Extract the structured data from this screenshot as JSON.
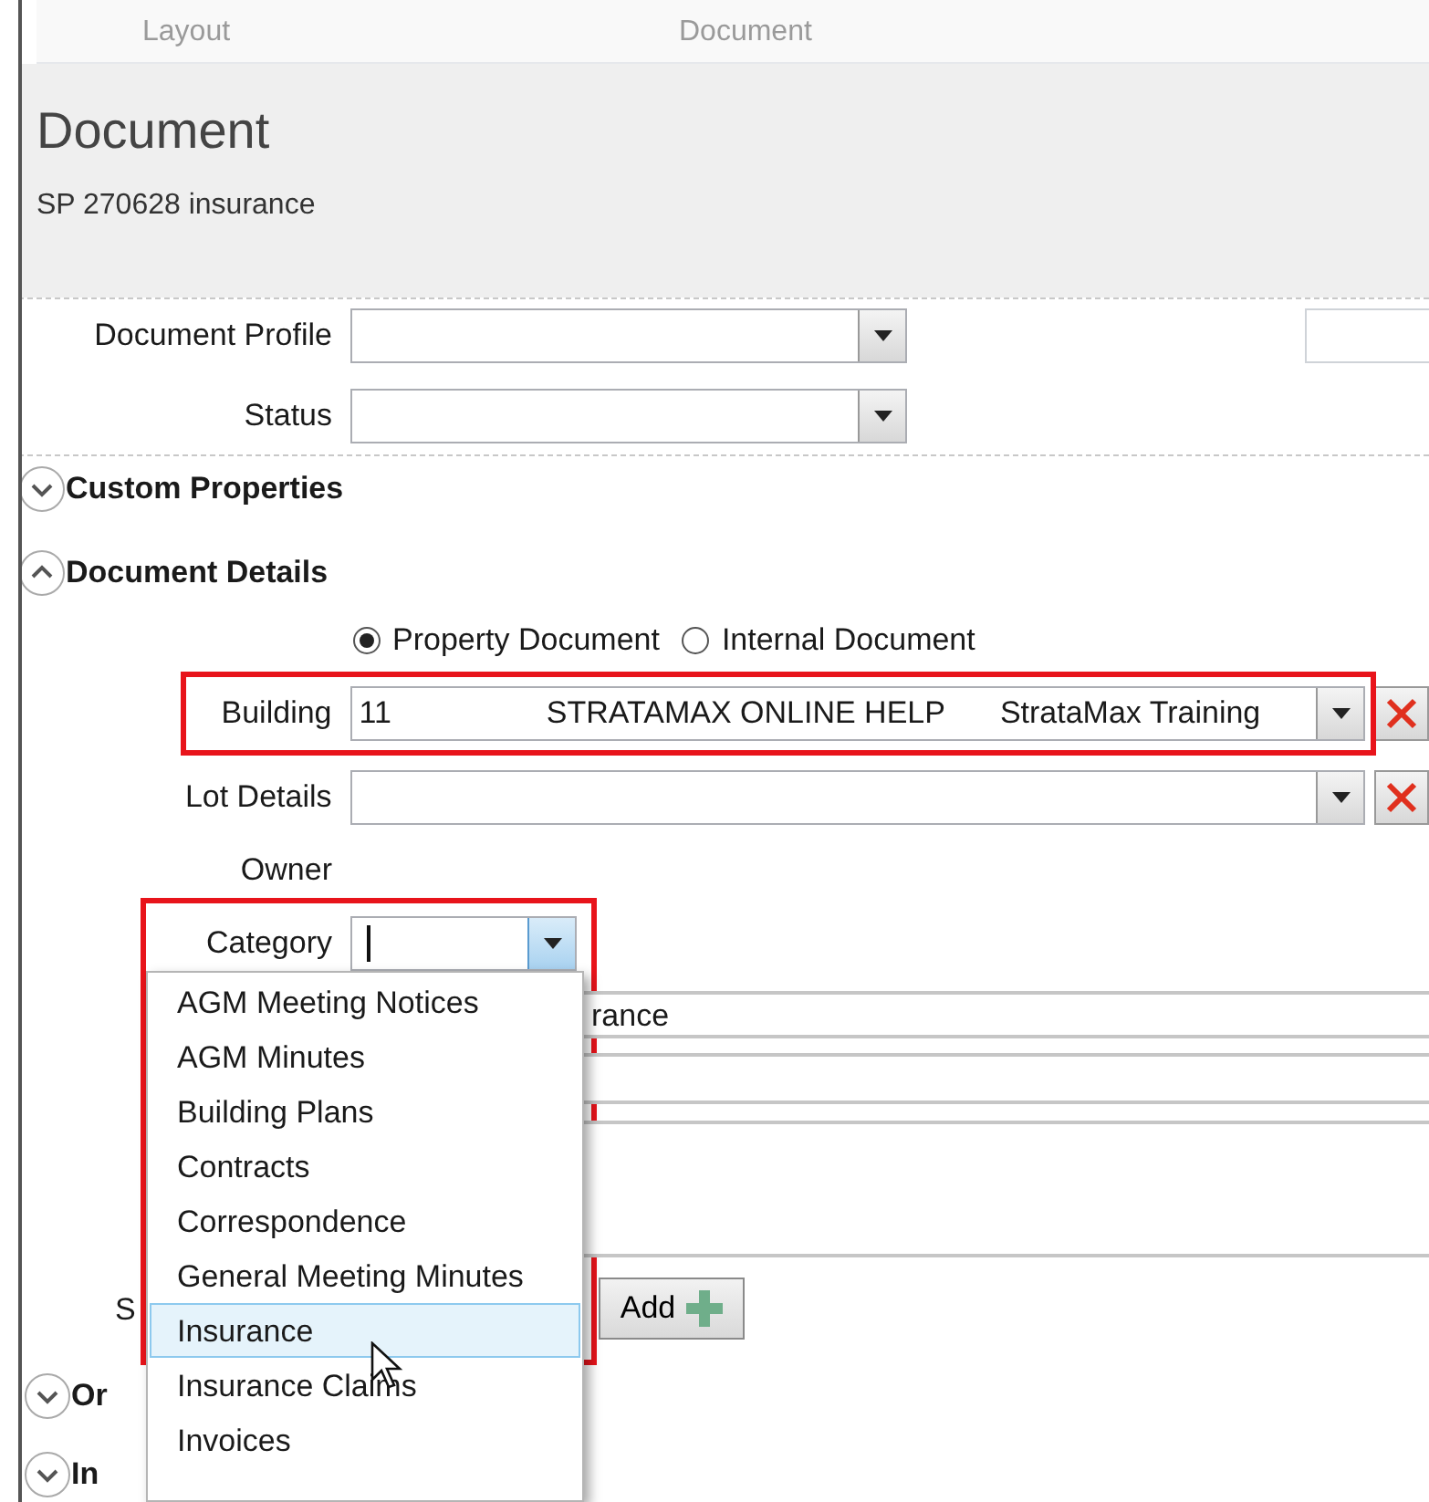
{
  "top_bar": {
    "items": [
      "Layout",
      "Document"
    ]
  },
  "header": {
    "title": "Document",
    "subtitle": "SP 270628 insurance"
  },
  "profile_fields": [
    {
      "label": "Document Profile"
    },
    {
      "label": "Status"
    }
  ],
  "sections": [
    {
      "title": "Custom Properties",
      "expanded": false
    },
    {
      "title": "Document Details",
      "expanded": true
    }
  ],
  "document_type": [
    {
      "label": "Property Document",
      "selected": true
    },
    {
      "label": "Internal Document",
      "selected": false
    }
  ],
  "building": {
    "label": "Building",
    "values": [
      "11",
      "STRATAMAX ONLINE HELP",
      "StrataMax Training"
    ],
    "highlighted": true
  },
  "lot_details": {
    "label": "Lot Details"
  },
  "owner": {
    "label": "Owner"
  },
  "category": {
    "label": "Category",
    "highlighted": true
  },
  "hidden_field": {
    "value": "rance"
  },
  "hidden_label": "S",
  "add_button": "Add",
  "category_options": [
    {
      "label": "AGM Meeting Notices",
      "selected": false
    },
    {
      "label": "AGM Minutes",
      "selected": false
    },
    {
      "label": "Building Plans",
      "selected": false
    },
    {
      "label": "Contracts",
      "selected": false
    },
    {
      "label": "Correspondence",
      "selected": false
    },
    {
      "label": "General Meeting Minutes",
      "selected": false
    },
    {
      "label": "Insurance",
      "selected": true
    },
    {
      "label": "Insurance Claims",
      "selected": false
    },
    {
      "label": "Invoices",
      "selected": false
    }
  ],
  "lower_sections": [
    {
      "title": "Or",
      "expanded": false
    },
    {
      "title": "In",
      "expanded": false
    }
  ]
}
